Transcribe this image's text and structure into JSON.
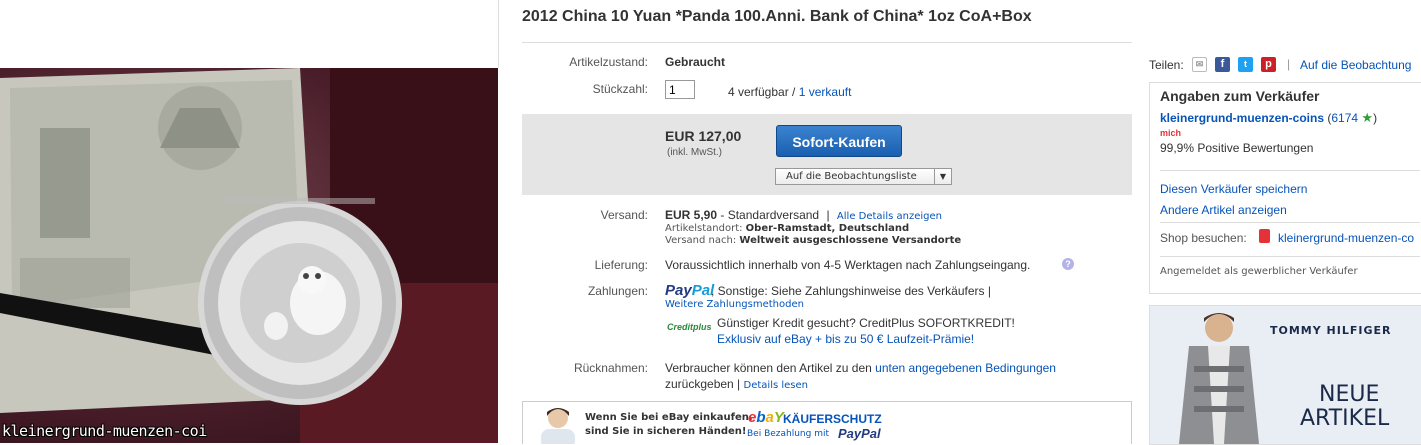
{
  "listing": {
    "title": "2012 China 10 Yuan *Panda 100.Anni. Bank of China* 1oz CoA+Box",
    "image_watermark": "kleinergrund-muenzen-coi"
  },
  "details": {
    "condition_label": "Artikelzustand:",
    "condition_value": "Gebraucht",
    "quantity_label": "Stückzahl:",
    "quantity_value": "1",
    "available": "4 verfügbar",
    "sold_sep": " / ",
    "sold": "1 verkauft"
  },
  "buy": {
    "price": "EUR 127,00",
    "tax_note": "(inkl. MwSt.)",
    "buy_now_label": "Sofort-Kaufen",
    "watchlist_label": "Auf die Beobachtungsliste",
    "watchlist_arrow": "▼"
  },
  "shipping": {
    "label": "Versand:",
    "cost": "EUR 5,90",
    "method": "- Standardversand",
    "sep": "|",
    "details_link": "Alle Details anzeigen",
    "location_label": "Artikelstandort:",
    "location_value": "Ober-Ramstadt, Deutschland",
    "ships_to_label": "Versand nach:",
    "ships_to_value": "Weltweit ausgeschlossene Versandorte"
  },
  "delivery": {
    "label": "Lieferung:",
    "text": "Voraussichtlich innerhalb von 4-5 Werktagen nach Zahlungseingang.",
    "help_icon": "?"
  },
  "payment": {
    "label": "Zahlungen:",
    "paypal_pay": "Pay",
    "paypal_pal": "Pal",
    "other_text": ", Sonstige: Siehe Zahlungshinweise des Verkäufers |",
    "more_methods_link": "Weitere Zahlungsmethoden",
    "creditplus_logo": "Creditplus",
    "credit_text": "Günstiger Kredit gesucht? CreditPlus SOFORTKREDIT!",
    "credit_link": "Exklusiv auf eBay + bis zu 50 € Laufzeit-Prämie!"
  },
  "returns": {
    "label": "Rücknahmen:",
    "text_before": "Verbraucher können den Artikel zu den ",
    "conditions_link": "unten angegebenen Bedingungen",
    "text_after": "zurückgeben |",
    "details_link": "Details lesen"
  },
  "protection": {
    "line1": "Wenn Sie bei eBay einkaufen,",
    "line2": "sind Sie in sicheren Händen!",
    "brand_e": "e",
    "brand_b": "b",
    "brand_a": "a",
    "brand_y": "Y",
    "brand_title": "KÄUFERSCHUTZ",
    "brand_sub": "Bei Bezahlung mit",
    "brand_paypal": "PayPal"
  },
  "share": {
    "label": "Teilen:",
    "separator": "|",
    "watch_link": "Auf die Beobachtung"
  },
  "seller": {
    "title": "Angaben zum Verkäufer",
    "name": "kleinergrund-muenzen-coins",
    "feedback_open": " (",
    "feedback_score": "6174",
    "feedback_close": ")",
    "me_badge": "mich",
    "positive": "99,9% Positive Bewertungen",
    "save_seller": "Diesen Verkäufer speichern",
    "other_items": "Andere Artikel anzeigen",
    "shop_label": "Shop besuchen:",
    "shop_name": "kleinergrund-muenzen-co",
    "business_note": "Angemeldet als gewerblicher Verkäufer"
  },
  "ad": {
    "brand": "TOMMY HILFIGER",
    "line1": "NEUE",
    "line2": "ARTIKEL"
  },
  "colors": {
    "link": "#0654ba",
    "buy_button": "#1a5fb0",
    "buybox_bg": "#e5e5e5"
  }
}
